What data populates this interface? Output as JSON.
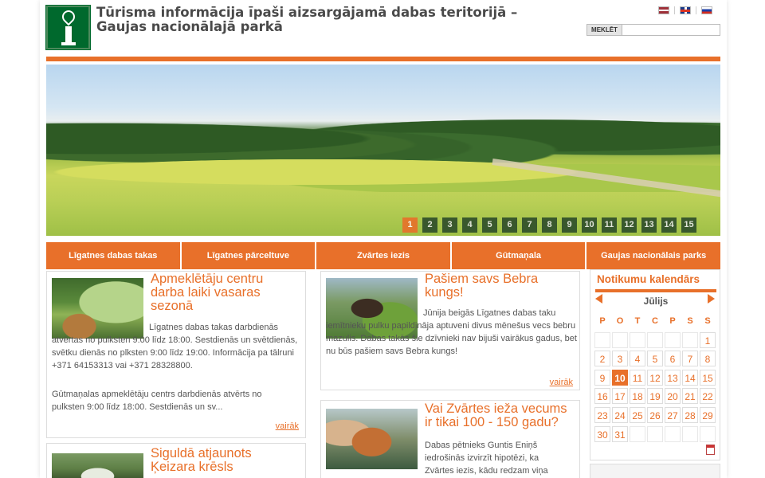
{
  "header": {
    "title": "Tūrisma informācija īpaši aizsargājamā dabas teritorijā – Gaujas nacionālajā parkā",
    "search_button": "MEKLĒT",
    "search_placeholder": "",
    "languages": [
      "lv",
      "en",
      "ru"
    ]
  },
  "banner": {
    "pages": [
      "1",
      "2",
      "3",
      "4",
      "5",
      "6",
      "7",
      "8",
      "9",
      "10",
      "11",
      "12",
      "13",
      "14",
      "15"
    ],
    "active_page": "1"
  },
  "nav": {
    "items": [
      "Līgatnes dabas takas",
      "Līgatnes pārceltuve",
      "Zvārtes iezis",
      "Gūtmaņala",
      "Gaujas nacionālais parks"
    ]
  },
  "articles": [
    {
      "title": "Apmeklētāju centru darba laiki vasaras sezonā",
      "body1": "Līgatnes dabas takas darbdienās atvērtas no pulksten 9:00 līdz 18:00. Sestdienās un svētdienās, svētku dienās no plksten 9:00 līdz 19:00. Informācija pa tālruni +371 64153313 vai +371 28328800.",
      "body2": "Gūtmaņalas apmeklētāju centrs darbdienās atvērts no pulksten 9:00 līdz 18:00. Sestdienās un sv...",
      "more": "vairāk"
    },
    {
      "title": "Pašiem savs Bebra kungs!",
      "body1": "Jūnija beigās Līgatnes dabas taku iemītnieku pulku papildināja aptuveni divus mēnešus vecs bebru mazulis. Dabas takās šie dzīvnieki nav bijuši vairākus gadus, bet nu būs pašiem savs Bebra kungs!",
      "more": "vairāk"
    },
    {
      "title": "Vai Zvārtes ieža vecums ir tikai 100 - 150 gadu?",
      "body1": "Dabas pētnieks Guntis Eniņš iedrošinās izvirzīt hipotēzi, ka Zvārtes iezis, kādu redzam viņa"
    },
    {
      "title": "Siguldā atjaunots Ķeizara krēsls"
    }
  ],
  "calendar": {
    "title": "Notikumu kalendārs",
    "month": "Jūlijs",
    "weekdays": [
      "P",
      "O",
      "T",
      "C",
      "P",
      "S",
      "S"
    ],
    "weeks": [
      [
        "",
        "",
        "",
        "",
        "",
        "",
        "1"
      ],
      [
        "2",
        "3",
        "4",
        "5",
        "6",
        "7",
        "8"
      ],
      [
        "9",
        "10",
        "11",
        "12",
        "13",
        "14",
        "15"
      ],
      [
        "16",
        "17",
        "18",
        "19",
        "20",
        "21",
        "22"
      ],
      [
        "23",
        "24",
        "25",
        "26",
        "27",
        "28",
        "29"
      ],
      [
        "30",
        "31",
        "",
        "",
        "",
        "",
        ""
      ]
    ],
    "today": "10"
  },
  "colors": {
    "accent": "#e8702a",
    "logo_green": "#00692d"
  }
}
